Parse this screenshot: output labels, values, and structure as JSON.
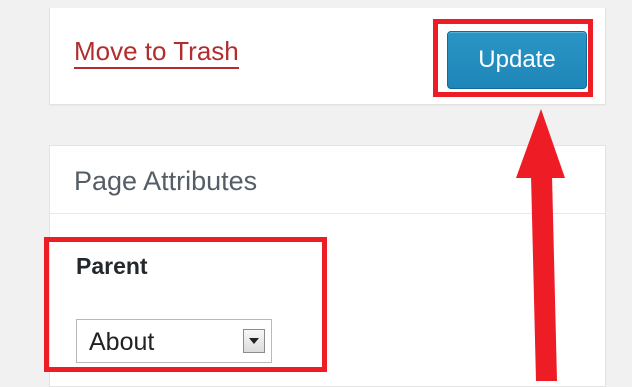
{
  "publish": {
    "trash_label": "Move to Trash",
    "update_label": "Update"
  },
  "attributes": {
    "title": "Page Attributes",
    "parent_label": "Parent",
    "parent_value": "About"
  },
  "colors": {
    "highlight": "#ee1c25",
    "update_button": "#2a95c5",
    "trash_link": "#b32d2e"
  }
}
